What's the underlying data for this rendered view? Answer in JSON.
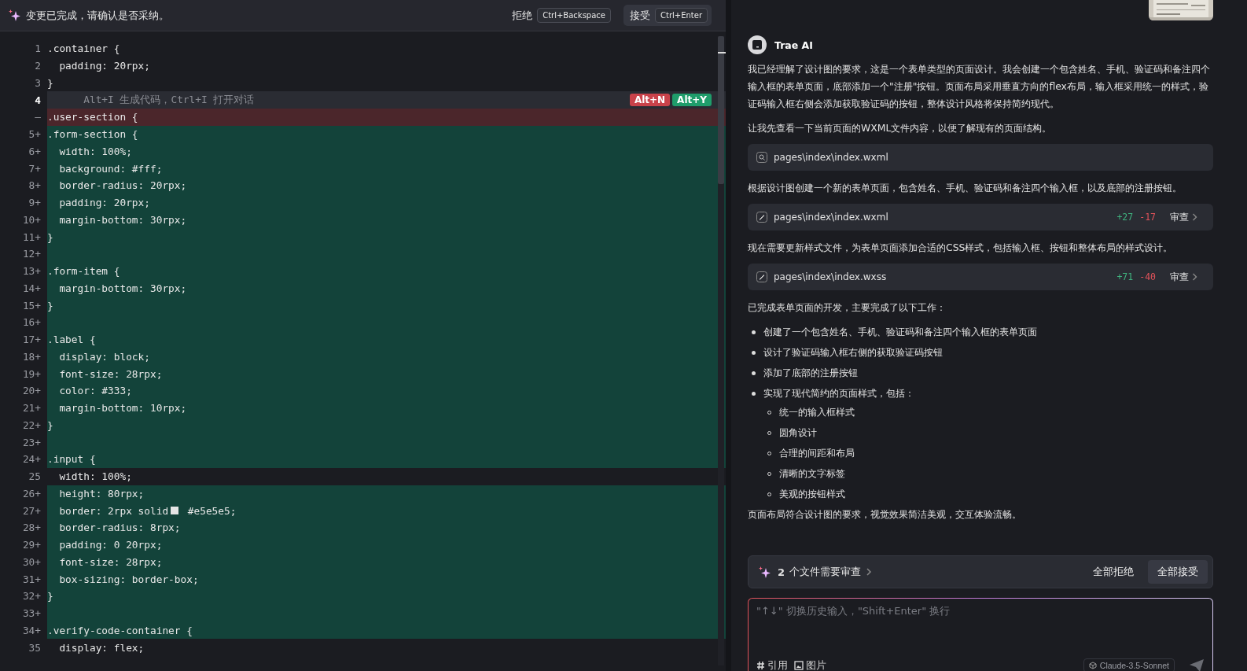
{
  "diff_bar": {
    "message": "变更已完成，请确认是否采纳。",
    "reject": {
      "label": "拒绝",
      "shortcut": "Ctrl+Backspace"
    },
    "accept": {
      "label": "接受",
      "shortcut": "Ctrl+Enter"
    }
  },
  "code_lines": [
    {
      "number": "1",
      "kind": "same",
      "text": ".container {"
    },
    {
      "number": "2",
      "kind": "same",
      "text": "  padding: 20rpx;"
    },
    {
      "number": "3",
      "kind": "same",
      "text": "}"
    },
    {
      "number": "4",
      "kind": "hint",
      "text": "      Alt+I 生成代码，Ctrl+I 打开对话",
      "badges": [
        {
          "label": "Alt+N",
          "color": "#c9424a"
        },
        {
          "label": "Alt+Y",
          "color": "#1f9d6b"
        }
      ]
    },
    {
      "number": "—",
      "kind": "removed",
      "text": ".user-section {"
    },
    {
      "number": "5+",
      "kind": "added",
      "text": ".form-section {"
    },
    {
      "number": "6+",
      "kind": "added",
      "text": "  width: 100%;"
    },
    {
      "number": "7+",
      "kind": "added",
      "text": "  background: #fff;"
    },
    {
      "number": "8+",
      "kind": "added",
      "text": "  border-radius: 20rpx;"
    },
    {
      "number": "9+",
      "kind": "added",
      "text": "  padding: 20rpx;"
    },
    {
      "number": "10+",
      "kind": "added",
      "text": "  margin-bottom: 30rpx;"
    },
    {
      "number": "11+",
      "kind": "added",
      "text": "}"
    },
    {
      "number": "12+",
      "kind": "added"
    },
    {
      "number": "13+",
      "kind": "added",
      "text": ".form-item {"
    },
    {
      "number": "14+",
      "kind": "added",
      "text": "  margin-bottom: 30rpx;"
    },
    {
      "number": "15+",
      "kind": "added",
      "text": "}"
    },
    {
      "number": "16+",
      "kind": "added"
    },
    {
      "number": "17+",
      "kind": "added",
      "text": ".label {"
    },
    {
      "number": "18+",
      "kind": "added",
      "text": "  display: block;"
    },
    {
      "number": "19+",
      "kind": "added",
      "text": "  font-size: 28rpx;"
    },
    {
      "number": "20+",
      "kind": "added",
      "text": "  color: #333;"
    },
    {
      "number": "21+",
      "kind": "added",
      "text": "  margin-bottom: 10rpx;"
    },
    {
      "number": "22+",
      "kind": "added",
      "text": "}"
    },
    {
      "number": "23+",
      "kind": "added"
    },
    {
      "number": "24+",
      "kind": "added",
      "text": ".input {"
    },
    {
      "number": "25",
      "kind": "same",
      "text": "  width: 100%;"
    },
    {
      "number": "26+",
      "kind": "added",
      "text": "  height: 80rpx;"
    },
    {
      "number": "27+",
      "kind": "added",
      "text": "  border: 2rpx solid",
      "swatch": true,
      "text_after": " #e5e5e5;"
    },
    {
      "number": "28+",
      "kind": "added",
      "text": "  border-radius: 8rpx;"
    },
    {
      "number": "29+",
      "kind": "added",
      "text": "  padding: 0 20rpx;"
    },
    {
      "number": "30+",
      "kind": "added",
      "text": "  font-size: 28rpx;"
    },
    {
      "number": "31+",
      "kind": "added",
      "text": "  box-sizing: border-box;"
    },
    {
      "number": "32+",
      "kind": "added",
      "text": "}"
    },
    {
      "number": "33+",
      "kind": "added"
    },
    {
      "number": "34+",
      "kind": "added",
      "text": ".verify-code-container {"
    },
    {
      "number": "35",
      "kind": "same",
      "text": "  display: flex;"
    }
  ],
  "chat": {
    "assistant": "Trae AI",
    "blocks": [
      {
        "kind": "paragraph",
        "text": "我已经理解了设计图的要求，这是一个表单类型的页面设计。我会创建一个包含姓名、手机、验证码和备注四个输入框的表单页面，底部添加一个\"注册\"按钮。页面布局采用垂直方向的flex布局，输入框采用统一的样式，验证码输入框右侧会添加获取验证码的按钮，整体设计风格将保持简约现代。"
      },
      {
        "kind": "paragraph",
        "text": "让我先查看一下当前页面的WXML文件内容，以便了解现有的页面结构。"
      },
      {
        "kind": "file-read",
        "path": "pages\\index\\index.wxml"
      },
      {
        "kind": "paragraph",
        "text": "根据设计图创建一个新的表单页面，包含姓名、手机、验证码和备注四个输入框，以及底部的注册按钮。"
      },
      {
        "kind": "file-edit",
        "path": "pages\\index\\index.wxml",
        "added": "+27",
        "removed": "-17",
        "action": "审查"
      },
      {
        "kind": "paragraph",
        "text": "现在需要更新样式文件，为表单页面添加合适的CSS样式，包括输入框、按钮和整体布局的样式设计。"
      },
      {
        "kind": "file-edit",
        "path": "pages\\index\\index.wxss",
        "added": "+71",
        "removed": "-40",
        "action": "审查"
      },
      {
        "kind": "paragraph",
        "text": "已完成表单页面的开发，主要完成了以下工作："
      },
      {
        "kind": "list",
        "items": [
          {
            "text": "创建了一个包含姓名、手机、验证码和备注四个输入框的表单页面"
          },
          {
            "text": "设计了验证码输入框右侧的获取验证码按钮"
          },
          {
            "text": "添加了底部的注册按钮"
          },
          {
            "text": "实现了现代简约的页面样式，包括：",
            "children": [
              {
                "text": "统一的输入框样式"
              },
              {
                "text": "圆角设计"
              },
              {
                "text": "合理的间距和布局"
              },
              {
                "text": "清晰的文字标签"
              },
              {
                "text": "美观的按钮样式"
              }
            ]
          }
        ]
      },
      {
        "kind": "paragraph",
        "text": "页面布局符合设计图的要求，视觉效果简洁美观，交互体验流畅。"
      }
    ],
    "review": {
      "count": "2",
      "text": "个文件需要审查",
      "reject_all": "全部拒绝",
      "accept_all": "全部接受"
    },
    "input": {
      "placeholder": "\"↑↓\" 切换历史输入，\"Shift+Enter\" 换行",
      "reference": "引用",
      "image": "图片",
      "model": "Claude-3.5-Sonnet"
    }
  }
}
